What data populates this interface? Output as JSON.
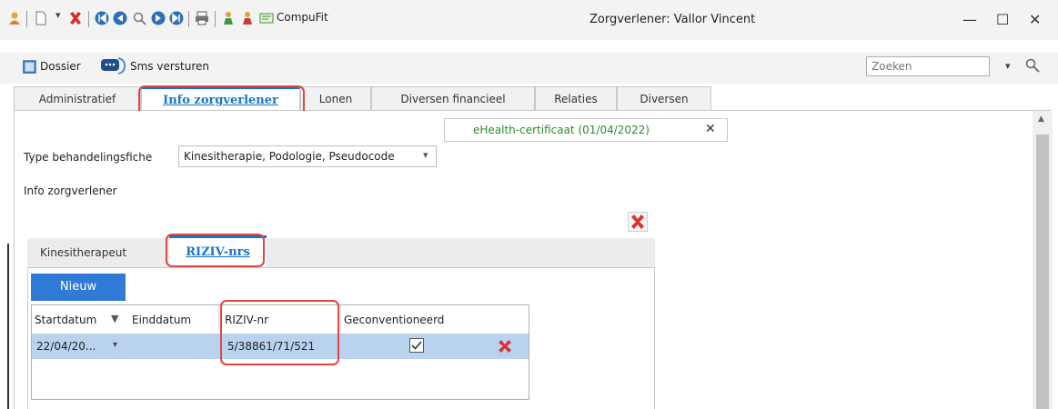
{
  "window": {
    "title": "Zorgverlener: Vallor Vincent",
    "compufit_label": "CompuFit",
    "minimize_glyph": "—",
    "maximize_glyph": "☐",
    "close_glyph": "✕"
  },
  "toolbar2": {
    "dossier_label": "Dossier",
    "sms_label": "Sms versturen",
    "search_placeholder": "Zoeken"
  },
  "main_tabs": [
    {
      "label": "Administratief"
    },
    {
      "label": "Info zorgverlener"
    },
    {
      "label": "Lonen"
    },
    {
      "label": "Diversen financieel"
    },
    {
      "label": "Relaties"
    },
    {
      "label": "Diversen"
    }
  ],
  "ehealth": {
    "label": "eHealth-certificaat (01/04/2022)",
    "close_glyph": "✕",
    "color": "#2e8b2e"
  },
  "form": {
    "type_label": "Type behandelingsfiche",
    "type_value": "Kinesitherapie, Podologie, Pseudocode",
    "section_label": "Info zorgverlener"
  },
  "inner_tabs": [
    {
      "label": "Kinesitherapeut"
    },
    {
      "label": "RIZIV-nrs"
    }
  ],
  "new_button": {
    "label": "Nieuw",
    "color": "#2f7bd5"
  },
  "grid": {
    "headers": [
      "Startdatum",
      "Einddatum",
      "RIZIV-nr",
      "Geconventioneerd"
    ],
    "rows": [
      {
        "startdatum": "22/04/20...",
        "einddatum": "",
        "riziv": "5/38861/71/521",
        "geconventioneerd": true
      }
    ]
  },
  "colors": {
    "accent": "#1874cd",
    "highlight": "#e34444",
    "row_selected": "#b9d3ee"
  },
  "icons": {
    "delete": "delete-x-icon",
    "checkbox": "checkbox-checked-icon"
  }
}
